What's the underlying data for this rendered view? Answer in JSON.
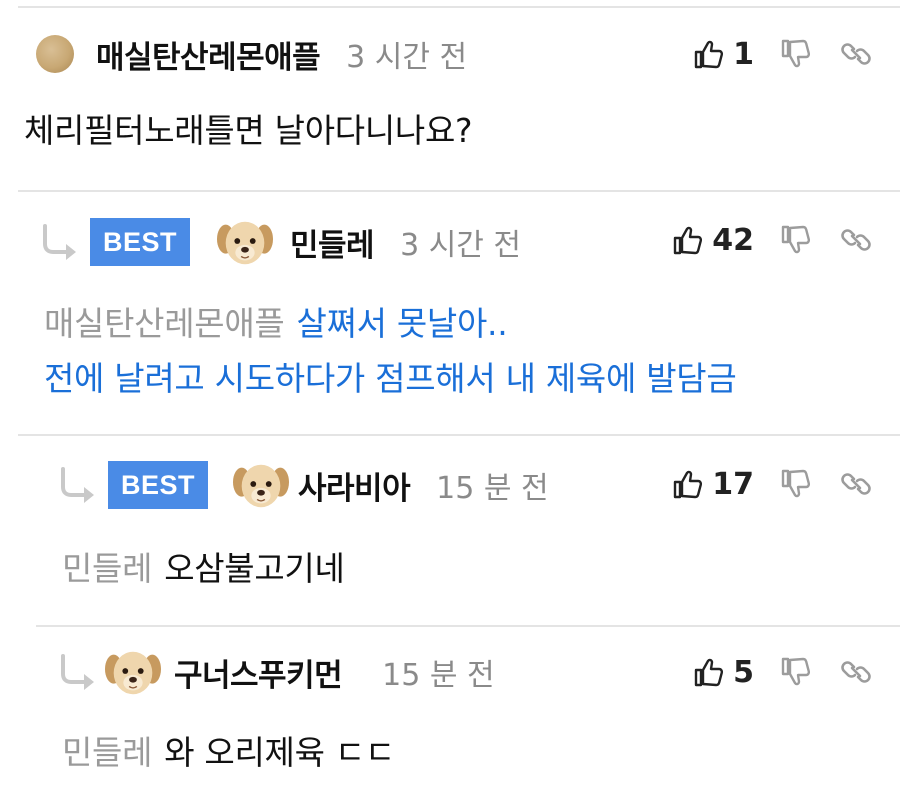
{
  "comments": [
    {
      "nickname": "매실탄산레몬애플",
      "time": "3 시간 전",
      "likes": "1",
      "text": "체리필터노래틀면 날아다니나요?"
    },
    {
      "badge": "BEST",
      "nickname": "민들레",
      "time": "3 시간 전",
      "likes": "42",
      "mention": "매실탄산레몬애플",
      "text_line1": "살쪄서 못날아..",
      "text_line2": "전에 날려고 시도하다가 점프해서 내 제육에 발담금"
    },
    {
      "badge": "BEST",
      "nickname": "사라비아",
      "time": "15 분 전",
      "likes": "17",
      "mention": "민들레",
      "text": "오삼불고기네"
    },
    {
      "nickname": "구너스푸키먼",
      "time": "15 분 전",
      "likes": "5",
      "mention": "민들레",
      "text": "와 오리제육 ㄷㄷ"
    }
  ],
  "icons": {
    "like": "thumbs-up-icon",
    "dislike": "thumbs-down-icon",
    "link": "link-icon",
    "reply": "reply-arrow-icon"
  },
  "colors": {
    "best_badge": "#4a8be6",
    "highlight_text": "#1a6fd8",
    "muted_text": "#8a8a8a",
    "divider": "#e4e4e4"
  }
}
